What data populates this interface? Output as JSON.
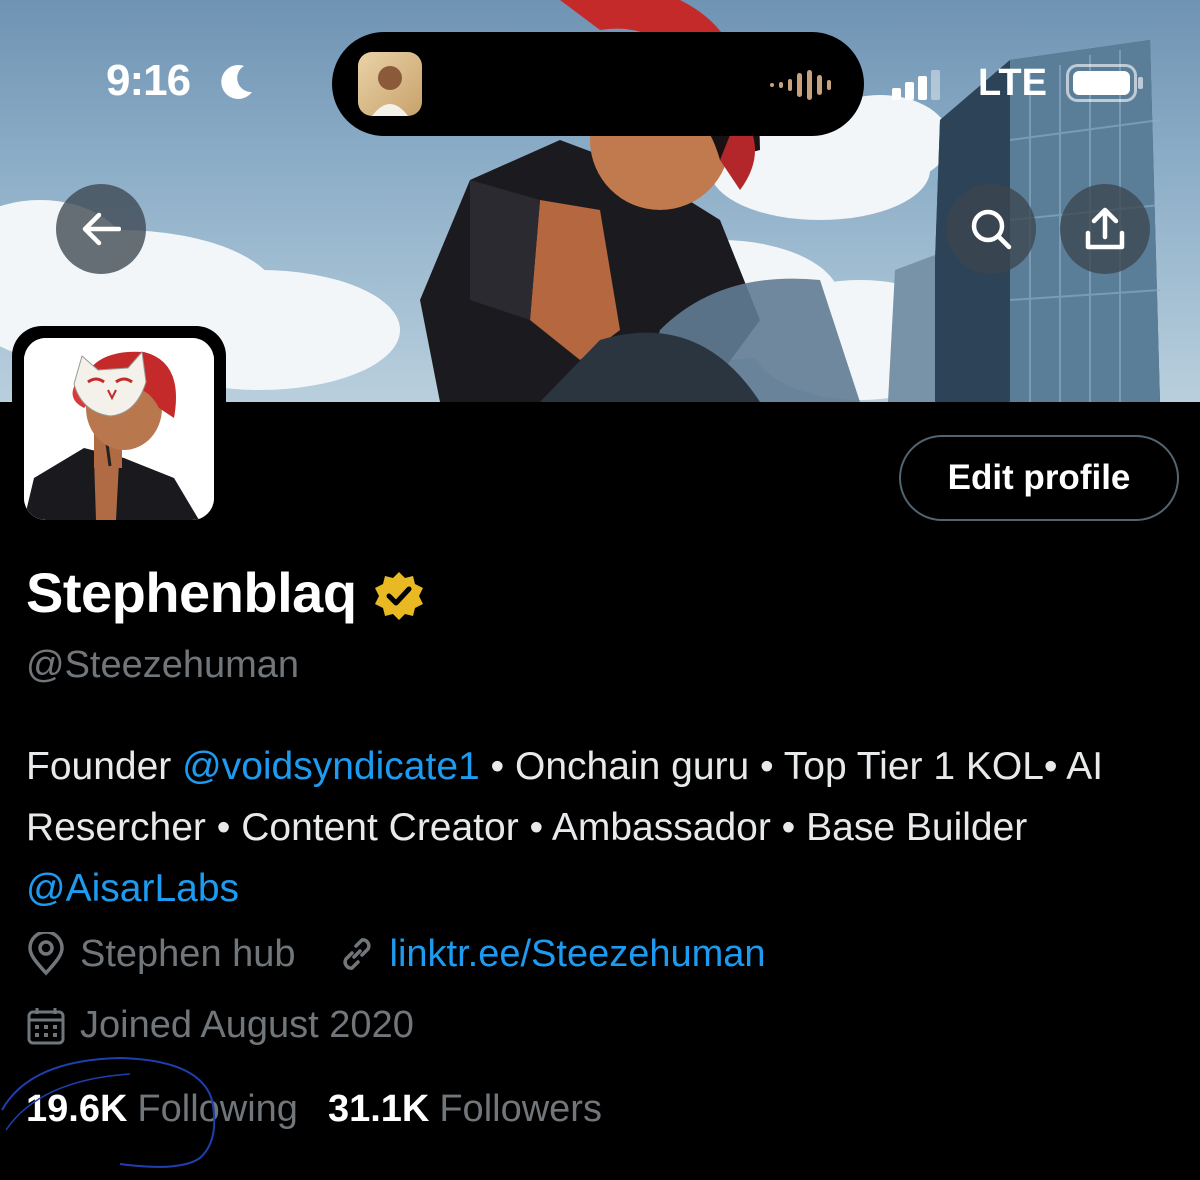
{
  "status_bar": {
    "time": "9:16",
    "network": "LTE",
    "icons": [
      "moon-icon",
      "audio-wave-icon",
      "signal-icon",
      "battery-icon"
    ]
  },
  "header": {
    "icons": [
      "back-arrow-icon",
      "search-icon",
      "share-icon"
    ]
  },
  "profile": {
    "edit_label": "Edit profile",
    "display_name": "Stephenblaq",
    "handle": "@Steezehuman",
    "verified_color": "#e8b923",
    "bio": {
      "p1": "Founder ",
      "m1": "@voidsyndicate1",
      "p2": " • Onchain guru • Top Tier 1 KOL• AI Resercher • Content Creator • Ambassador • Base Builder ",
      "m2": "@AisarLabs"
    },
    "location": "Stephen hub",
    "link": "linktr.ee/Steezehuman",
    "joined": "Joined August 2020",
    "following_count": "19.6K",
    "following_label": "Following",
    "followers_count": "31.1K",
    "followers_label": "Followers"
  },
  "colors": {
    "accent": "#1d9bf0",
    "background": "#000000",
    "muted": "#71767b"
  }
}
